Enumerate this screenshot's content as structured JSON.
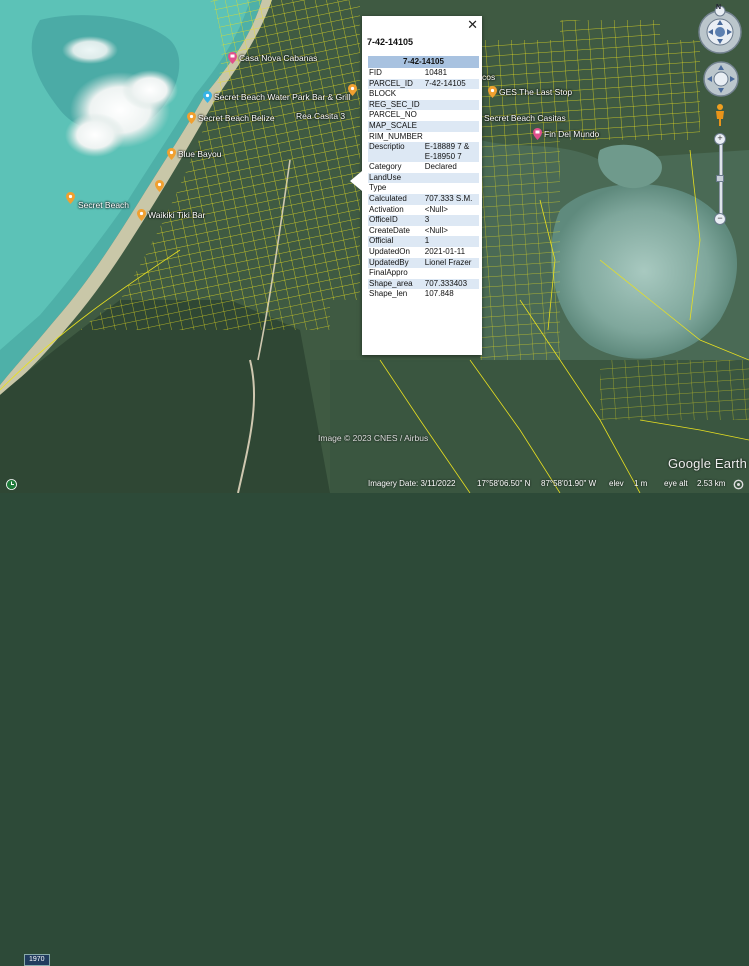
{
  "map": {
    "places": [
      {
        "name": "Casa Nova Cabanas",
        "icon": "hotel-pin-icon",
        "color": "#e04f8c"
      },
      {
        "name": "Secret Beach Water Park Bar & Grill",
        "icon": "place-pin-icon",
        "color": "#37b3e6"
      },
      {
        "name": "Secret Beach Belize",
        "icon": "place-pin-icon",
        "color": "#f0a030"
      },
      {
        "name": "Blue Bayou",
        "icon": "place-pin-icon",
        "color": "#f0a030"
      },
      {
        "name": "Secret Beach",
        "icon": "place-pin-icon",
        "color": "#f0a030"
      },
      {
        "name": "Waikiki Tiki Bar",
        "icon": "place-pin-icon",
        "color": "#f0a030"
      },
      {
        "name": "Rea Casita 3",
        "icon": "none",
        "color": "#ffffff"
      },
      {
        "name": "GES The Last Stop",
        "icon": "place-pin-icon",
        "color": "#f0a030"
      },
      {
        "name": "Fin Del Mundo",
        "icon": "hotel-pin-icon",
        "color": "#e04f8c"
      },
      {
        "name": "Secret Beach Casitas",
        "icon": "none",
        "color": "#ffffff"
      },
      {
        "name": "cos",
        "icon": "none",
        "color": "#ffffff"
      }
    ],
    "attribution": "Image © 2023 CNES / Airbus",
    "brand": "Google Earth",
    "parcel_line_color": "#e8e020"
  },
  "popup": {
    "title": "7-42-14105",
    "header": "7-42-14105",
    "close_label": "✕",
    "rows": [
      {
        "k": "FID",
        "v": "10481"
      },
      {
        "k": "PARCEL_ID",
        "v": "7-42-14105"
      },
      {
        "k": "BLOCK",
        "v": ""
      },
      {
        "k": "REG_SEC_ID",
        "v": ""
      },
      {
        "k": "PARCEL_NO",
        "v": ""
      },
      {
        "k": "MAP_SCALE",
        "v": ""
      },
      {
        "k": "RIM_NUMBER",
        "v": ""
      },
      {
        "k": "Descriptio",
        "v": "E-18889 7 & E-18950 7"
      },
      {
        "k": "Category",
        "v": "Declared"
      },
      {
        "k": "LandUse",
        "v": ""
      },
      {
        "k": "Type",
        "v": ""
      },
      {
        "k": "Calculated",
        "v": "707.333 S.M."
      },
      {
        "k": "Activation",
        "v": "<Null>"
      },
      {
        "k": "OfficeID",
        "v": "3"
      },
      {
        "k": "CreateDate",
        "v": "<Null>"
      },
      {
        "k": "Official",
        "v": "1"
      },
      {
        "k": "UpdatedOn",
        "v": "2021-01-11"
      },
      {
        "k": "UpdatedBy",
        "v": "Lionel Frazer"
      },
      {
        "k": "FinalAppro",
        "v": ""
      },
      {
        "k": "Shape_area",
        "v": "707.333403"
      },
      {
        "k": "Shape_len",
        "v": "107.848"
      }
    ]
  },
  "controls": {
    "compass_label": "N",
    "zoom_plus": "+",
    "zoom_minus": "−"
  },
  "status": {
    "year": "1970",
    "imagery_date": "Imagery Date: 3/11/2022",
    "lat": "17°58'06.50\" N",
    "lon": "87°58'01.90\" W",
    "elev_label": "elev",
    "elev": "1 m",
    "eye_alt_label": "eye alt",
    "eye_alt": "2.53 km"
  }
}
